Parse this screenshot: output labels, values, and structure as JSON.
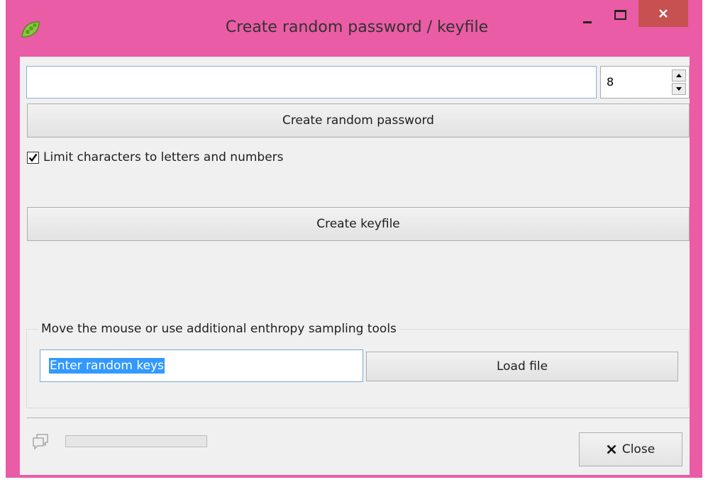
{
  "window": {
    "title": "Create random password / keyfile",
    "icon": "pea-pod-icon",
    "accent_color": "#ea5ca5",
    "close_button_color": "#c75050"
  },
  "password": {
    "value": "",
    "length": "8",
    "create_button": "Create random password",
    "limit_checkbox_label": "Limit characters to letters and numbers",
    "limit_checked": true
  },
  "keyfile": {
    "create_button": "Create keyfile"
  },
  "entropy": {
    "group_label": "Move the mouse or use additional enthropy sampling tools",
    "input_value": "Enter random keys",
    "load_button": "Load file"
  },
  "footer": {
    "progress_percent": 0,
    "progress_color": "#06b025",
    "close_button": "Close",
    "status_icon": "chat-bubbles-icon"
  }
}
